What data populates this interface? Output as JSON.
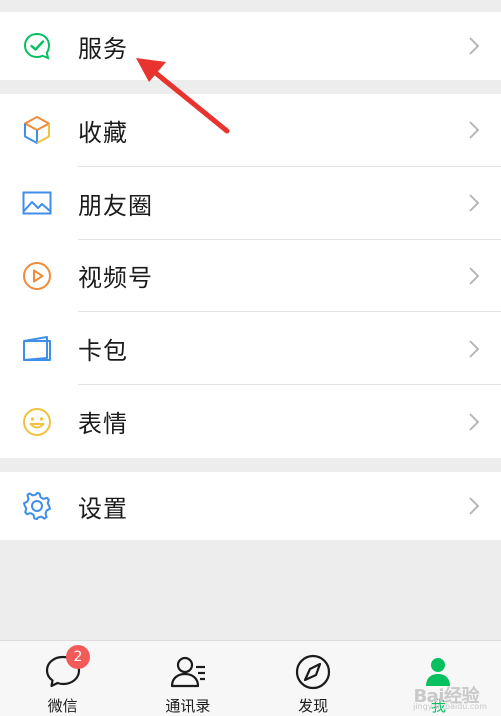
{
  "menu": {
    "services": {
      "label": "服务",
      "icon": "services-check-icon"
    },
    "items": [
      {
        "label": "收藏",
        "icon": "favorites-cube-icon"
      },
      {
        "label": "朋友圈",
        "icon": "moments-image-icon"
      },
      {
        "label": "视频号",
        "icon": "channels-play-icon"
      },
      {
        "label": "卡包",
        "icon": "card-wallet-icon"
      },
      {
        "label": "表情",
        "icon": "sticker-smile-icon"
      }
    ],
    "settings": {
      "label": "设置",
      "icon": "settings-gear-icon"
    }
  },
  "tabbar": {
    "tabs": [
      {
        "label": "微信",
        "icon": "chat-bubble-icon",
        "badge": "2"
      },
      {
        "label": "通讯录",
        "icon": "contacts-icon"
      },
      {
        "label": "发现",
        "icon": "compass-icon"
      },
      {
        "label": "我",
        "icon": "me-person-icon",
        "active": true
      }
    ]
  },
  "watermark": {
    "text": "Bai经验",
    "url": "jingyan.baidu.com"
  },
  "colors": {
    "accent_green": "#07c160",
    "badge_red": "#f25b58",
    "annotation_red": "#e8332e",
    "background": "#ededed"
  }
}
